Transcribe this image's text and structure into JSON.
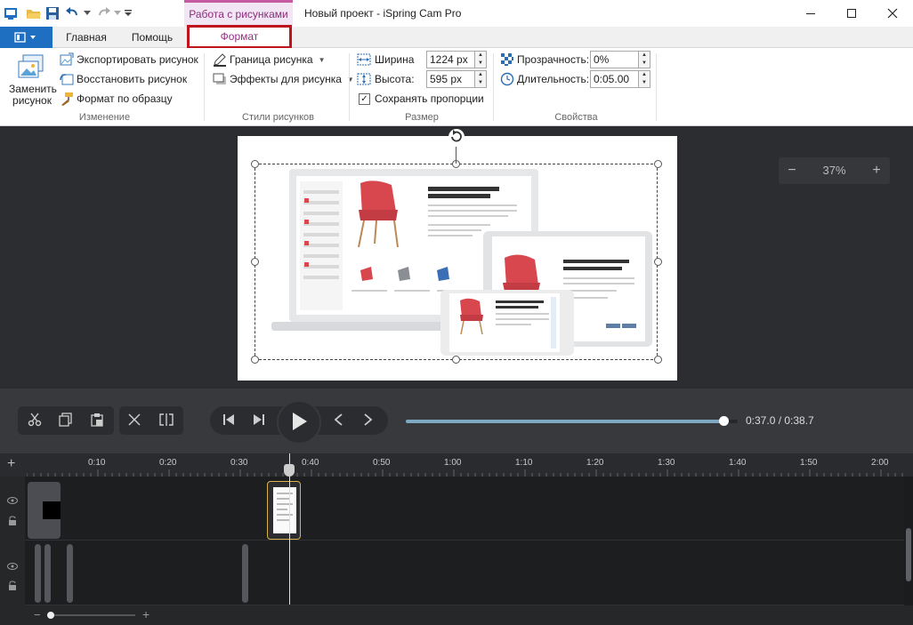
{
  "titlebar": {
    "contextual_tab": "Работа с рисунками",
    "window_title": "Новый проект - iSpring Cam Pro",
    "qa_icons": [
      "app-icon",
      "open-icon",
      "save-icon",
      "undo-icon",
      "redo-icon",
      "customize-icon"
    ]
  },
  "tabs": {
    "home": "Главная",
    "help": "Помощь",
    "format": "Формат"
  },
  "ribbon": {
    "change_group": {
      "label": "Изменение",
      "replace_line1": "Заменить",
      "replace_line2": "рисунок",
      "export": "Экспортировать рисунок",
      "restore": "Восстановить рисунок",
      "format_painter": "Формат по образцу"
    },
    "styles_group": {
      "label": "Стили рисунков",
      "border": "Граница рисунка",
      "effects": "Эффекты для рисунка"
    },
    "size_group": {
      "label": "Размер",
      "width_label": "Ширина",
      "width_value": "1224 px",
      "height_label": "Высота:",
      "height_value": "595 px",
      "keep_ratio": "Сохранять пропорции",
      "keep_ratio_checked": true
    },
    "props_group": {
      "label": "Свойства",
      "transparency_label": "Прозрачность:",
      "transparency_value": "0%",
      "duration_label": "Длительность:",
      "duration_value": "0:05.00"
    }
  },
  "canvas": {
    "zoom": "37%",
    "zoom_minus": "−",
    "zoom_plus": "+"
  },
  "player": {
    "timecode": "0:37.0 / 0:38.7",
    "progress": 0.956
  },
  "timeline": {
    "ticks": [
      "0:10",
      "0:20",
      "0:30",
      "0:40",
      "0:50",
      "1:00",
      "1:10",
      "1:20",
      "1:30",
      "1:40",
      "1:50",
      "2:00"
    ],
    "add": "+"
  },
  "colors": {
    "file_menu": "#1e6fc1",
    "highlight_border": "#c0141c",
    "contextual_tab": "#8a2e7a",
    "progress": "#7ea9c1",
    "chair_red": "#d9474e"
  }
}
